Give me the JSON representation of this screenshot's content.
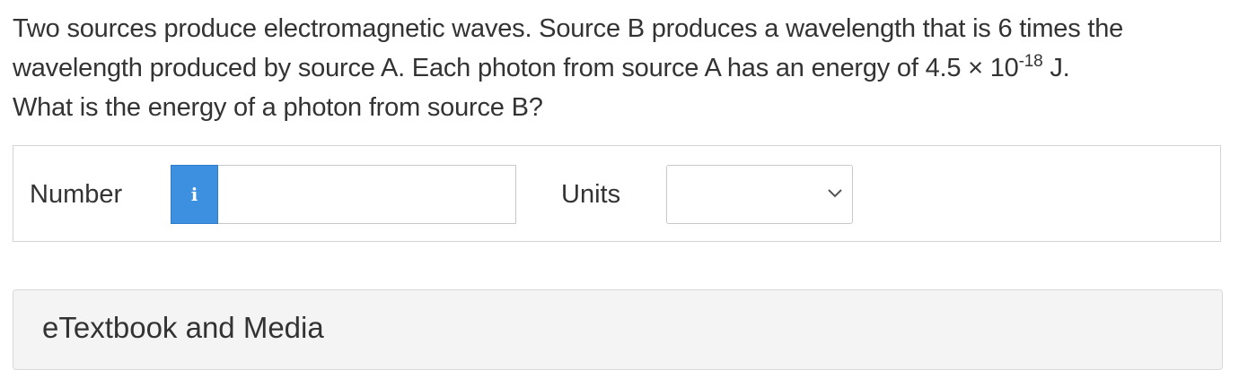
{
  "question": {
    "line1": "Two sources produce electromagnetic waves. Source B produces a wavelength that is 6 times the",
    "line2_before": "wavelength produced by source A. Each photon from source A has an energy of 4.5 × 10",
    "line2_exponent": "-18",
    "line2_after": " J.",
    "line3": "What is the energy of a photon from source B?"
  },
  "answer": {
    "number_label": "Number",
    "info_icon_glyph": "i",
    "number_value": "",
    "number_placeholder": "",
    "units_label": "Units",
    "units_selected": ""
  },
  "media": {
    "title": "eTextbook and Media"
  },
  "icons": {
    "info": "info-icon",
    "dropdown": "chevron-down-icon"
  },
  "colors": {
    "info_button": "#3d8fdf",
    "text": "#333333",
    "panel_background": "#f4f4f4"
  }
}
